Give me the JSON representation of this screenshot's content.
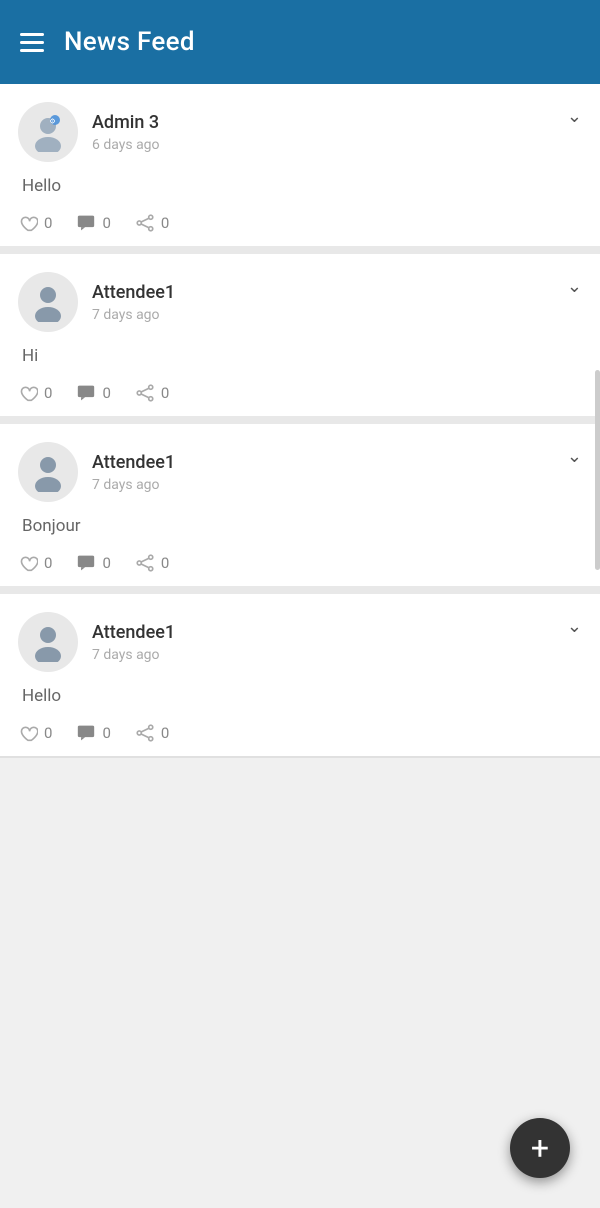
{
  "header": {
    "title": "News Feed",
    "menu_icon": "hamburger"
  },
  "posts": [
    {
      "id": "post-1",
      "user_name": "Admin 3",
      "time_ago": "6 days ago",
      "content": "Hello",
      "likes": 0,
      "comments": 0,
      "shares": 0,
      "avatar_type": "admin"
    },
    {
      "id": "post-2",
      "user_name": "Attendee1",
      "time_ago": "7 days ago",
      "content": "Hi",
      "likes": 0,
      "comments": 0,
      "shares": 0,
      "avatar_type": "attendee"
    },
    {
      "id": "post-3",
      "user_name": "Attendee1",
      "time_ago": "7 days ago",
      "content": "Bonjour",
      "likes": 0,
      "comments": 0,
      "shares": 0,
      "avatar_type": "attendee"
    },
    {
      "id": "post-4",
      "user_name": "Attendee1",
      "time_ago": "7 days ago",
      "content": "Hello",
      "likes": 0,
      "comments": 0,
      "shares": 0,
      "avatar_type": "attendee"
    }
  ],
  "fab": {
    "label": "+"
  }
}
